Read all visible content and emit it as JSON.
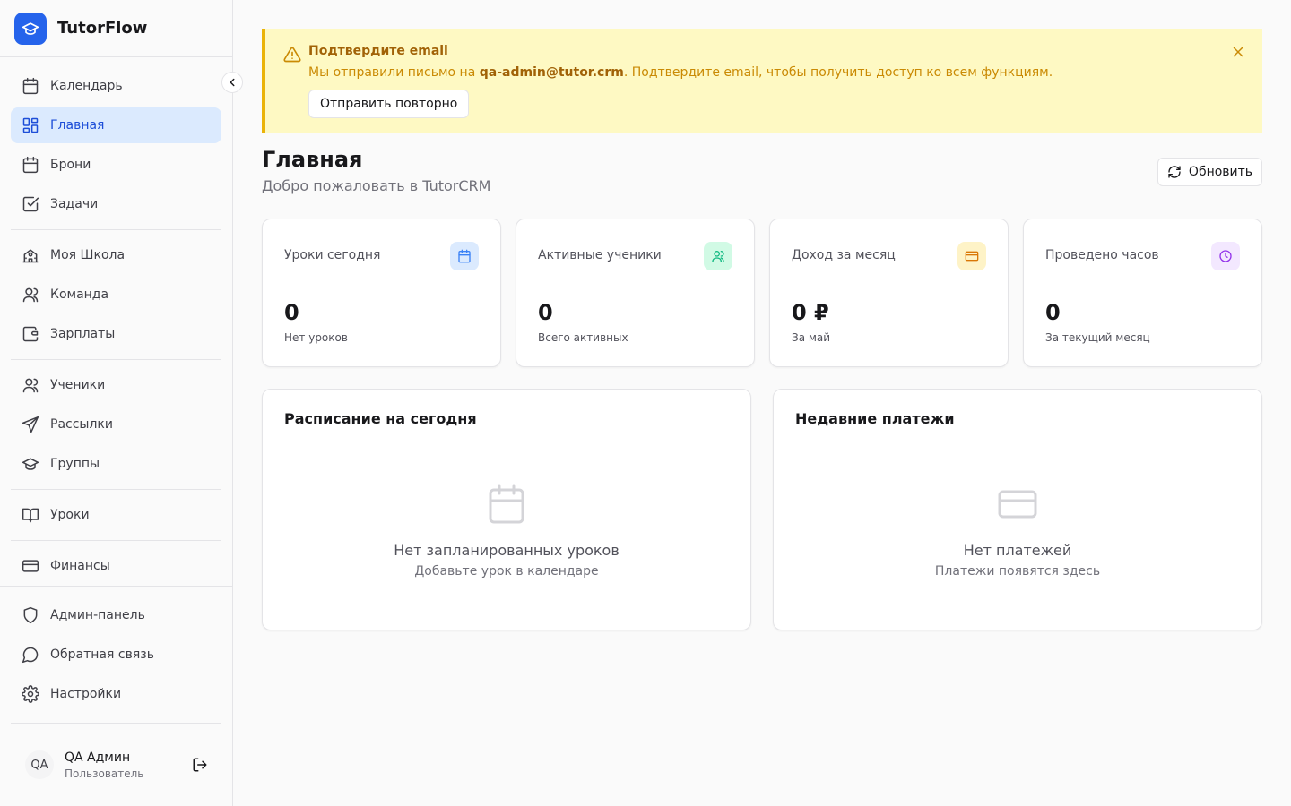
{
  "app": {
    "name": "TutorFlow",
    "brand_color": "#2563eb"
  },
  "sidebar": {
    "items": [
      {
        "label": "Календарь",
        "icon": "calendar-icon"
      },
      {
        "label": "Главная",
        "icon": "dashboard-icon",
        "active": true
      },
      {
        "label": "Брони",
        "icon": "calendar-icon"
      },
      {
        "label": "Задачи",
        "icon": "checkbox-icon"
      },
      {
        "label": "Моя Школа",
        "icon": "school-icon"
      },
      {
        "label": "Команда",
        "icon": "users-icon"
      },
      {
        "label": "Зарплаты",
        "icon": "wallet-icon"
      },
      {
        "label": "Ученики",
        "icon": "users-icon"
      },
      {
        "label": "Рассылки",
        "icon": "send-icon"
      },
      {
        "label": "Группы",
        "icon": "graduation-cap-icon"
      },
      {
        "label": "Уроки",
        "icon": "book-icon"
      },
      {
        "label": "Финансы",
        "icon": "credit-card-icon"
      },
      {
        "label": "Админ-панель",
        "icon": "shield-icon"
      },
      {
        "label": "Обратная связь",
        "icon": "message-icon"
      },
      {
        "label": "Настройки",
        "icon": "gear-icon"
      }
    ],
    "user": {
      "initials": "QA",
      "name": "QA Админ",
      "role": "Пользователь"
    }
  },
  "alert": {
    "title": "Подтвердите email",
    "message_prefix": "Мы отправили письмо на ",
    "email": "qa-admin@tutor.crm",
    "message_suffix": ". Подтвердите email, чтобы получить доступ ко всем функциям.",
    "button": "Отправить повторно"
  },
  "header": {
    "title": "Главная",
    "subtitle": "Добро пожаловать в TutorCRM",
    "refresh_label": "Обновить"
  },
  "stats": [
    {
      "label": "Уроки сегодня",
      "value": "0",
      "sub": "Нет уроков",
      "icon": "calendar-icon",
      "color": "#3b82f6"
    },
    {
      "label": "Активные ученики",
      "value": "0",
      "sub": "Всего активных",
      "icon": "users-icon",
      "color": "#10b981"
    },
    {
      "label": "Доход за месяц",
      "value": "0 ₽",
      "sub": "За май",
      "icon": "credit-card-icon",
      "color": "#d97706"
    },
    {
      "label": "Проведено часов",
      "value": "0",
      "sub": "За текущий месяц",
      "icon": "clock-icon",
      "color": "#9333ea"
    }
  ],
  "panels": {
    "schedule": {
      "title": "Расписание на сегодня",
      "empty_title": "Нет запланированных уроков",
      "empty_sub": "Добавьте урок в календаре"
    },
    "payments": {
      "title": "Недавние платежи",
      "empty_title": "Нет платежей",
      "empty_sub": "Платежи появятся здесь"
    }
  }
}
